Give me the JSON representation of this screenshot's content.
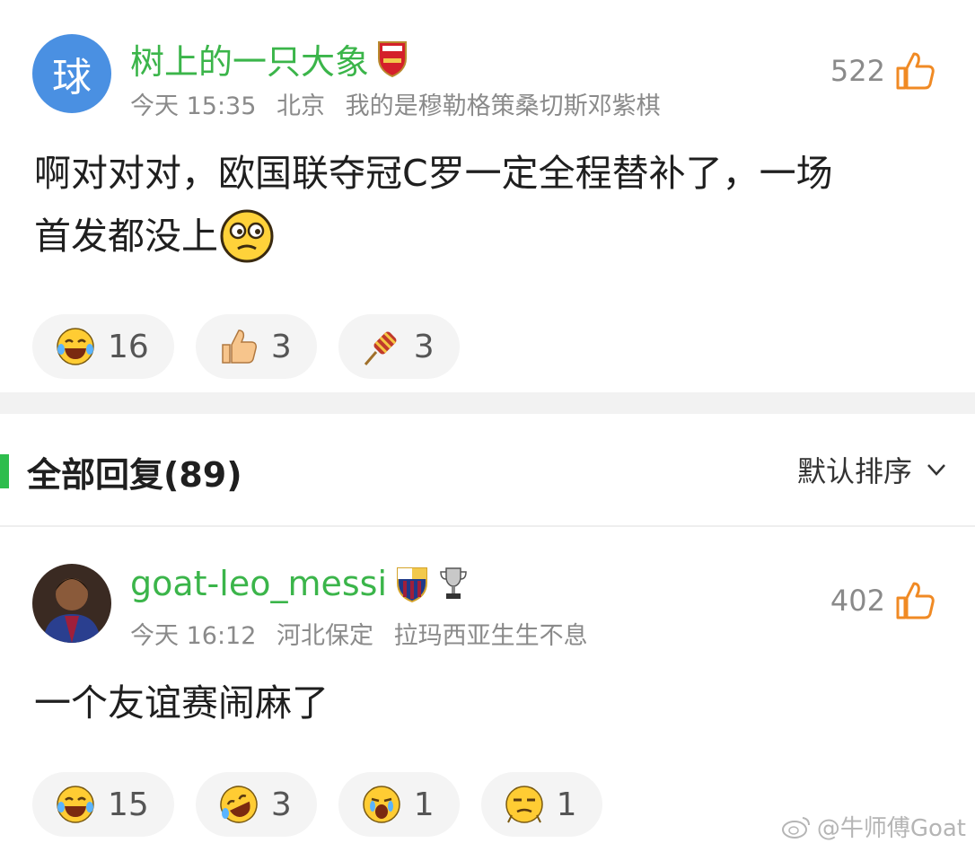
{
  "comment1": {
    "avatar_text": "球",
    "username": "树上的一只大象",
    "badge_icon": "arsenal-badge-icon",
    "time": "今天 15:35",
    "location": "北京",
    "team_label": "我的是穆勒格策桑切斯邓紫棋",
    "likes": "522",
    "text_line1": "啊对对对，欧国联夺冠C罗一定全程替补了，一场",
    "text_line2": "首发都没上",
    "reactions": [
      {
        "icon": "laughing-tears-emoji",
        "count": "16"
      },
      {
        "icon": "thumbs-up-emoji",
        "count": "3"
      },
      {
        "icon": "firecracker-emoji",
        "count": "3"
      }
    ]
  },
  "section": {
    "title": "全部回复(89)",
    "sort_label": "默认排序"
  },
  "comment2": {
    "username": "goat-leo_messi",
    "badge_icons": [
      "barcelona-badge-icon",
      "trophy-icon"
    ],
    "time": "今天 16:12",
    "location": "河北保定",
    "team_label": "拉玛西亚生生不息",
    "likes": "402",
    "text": "一个友谊赛闹麻了",
    "reactions": [
      {
        "icon": "laughing-tears-emoji",
        "count": "15"
      },
      {
        "icon": "rofl-emoji",
        "count": "3"
      },
      {
        "icon": "crying-emoji",
        "count": "1"
      },
      {
        "icon": "smirk-emoji",
        "count": "1"
      }
    ]
  },
  "watermark": "@牛师傅Goat",
  "colors": {
    "username_green": "#3bb54a",
    "like_orange": "#f08a24",
    "accent_green": "#2ebd4d"
  }
}
